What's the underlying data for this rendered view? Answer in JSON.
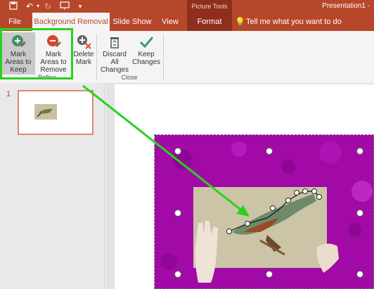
{
  "titlebar": {
    "context_label": "Picture Tools",
    "doc_title": "Presentation1 -"
  },
  "tabs": [
    {
      "label": "File"
    },
    {
      "label": "Background Removal"
    },
    {
      "label": "Slide Show"
    },
    {
      "label": "View"
    },
    {
      "label": "Format"
    }
  ],
  "tell_me": "Tell me what you want to do",
  "ribbon": {
    "buttons": [
      {
        "label": "Mark Areas to Keep"
      },
      {
        "label": "Mark Areas to Remove"
      },
      {
        "label": "Delete Mark"
      },
      {
        "label": "Discard All Changes"
      },
      {
        "label": "Keep Changes"
      }
    ],
    "groups": {
      "refine": "Refine",
      "close": "Close"
    }
  },
  "slides": {
    "number": "1"
  },
  "colors": {
    "accent": "#b7472a",
    "highlight": "#29d21f",
    "removal_overlay": "#a10aa6"
  }
}
